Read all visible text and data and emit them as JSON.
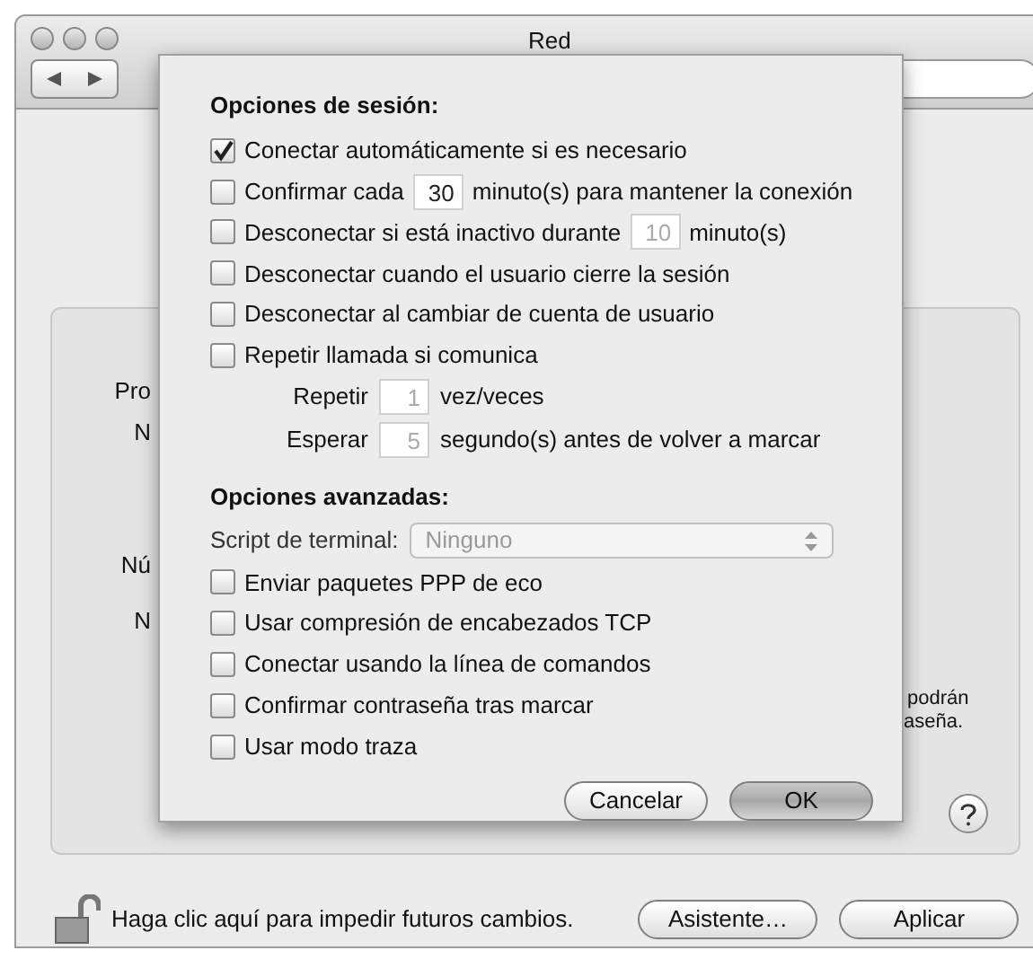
{
  "window": {
    "title": "Red"
  },
  "background_fragments": {
    "left": [
      "Pro",
      "N",
      "Nú",
      "N"
    ],
    "right": [
      "podrán",
      "aseña."
    ]
  },
  "sheet": {
    "session_title": "Opciones de sesión:",
    "session_options": [
      {
        "kind": "checkbox",
        "label": "Conectar automáticamente si es necesario",
        "checked": true
      },
      {
        "kind": "checkbox_field",
        "label": "Confirmar cada",
        "value": "30",
        "suffix": "minuto(s) para mantener la conexión",
        "checked": false,
        "field_disabled": false
      },
      {
        "kind": "checkbox_field",
        "label": "Desconectar si está inactivo durante",
        "value": "10",
        "suffix": "minuto(s)",
        "checked": false,
        "field_disabled": true
      },
      {
        "kind": "checkbox",
        "label": "Desconectar cuando el usuario cierre la sesión",
        "checked": false
      },
      {
        "kind": "checkbox",
        "label": "Desconectar al cambiar de cuenta de usuario",
        "checked": false
      },
      {
        "kind": "checkbox",
        "label": "Repetir llamada si comunica",
        "checked": false
      },
      {
        "kind": "field",
        "label": "Repetir",
        "value": "1",
        "suffix": "vez/veces",
        "field_disabled": true
      },
      {
        "kind": "field",
        "label": "Esperar",
        "value": "5",
        "suffix": "segundo(s) antes de volver a marcar",
        "field_disabled": true
      }
    ],
    "advanced_title": "Opciones avanzadas:",
    "script": {
      "label": "Script de terminal:",
      "value": "Ninguno",
      "disabled": true
    },
    "advanced_options": [
      {
        "label": "Enviar paquetes PPP de eco",
        "checked": false
      },
      {
        "label": "Usar compresión de encabezados TCP",
        "checked": false
      },
      {
        "label": "Conectar usando la línea de comandos",
        "checked": false
      },
      {
        "label": "Confirmar contraseña tras marcar",
        "checked": false
      },
      {
        "label": "Usar modo traza",
        "checked": false
      }
    ],
    "buttons": [
      {
        "label": "Cancelar",
        "default": false
      },
      {
        "label": "OK",
        "default": true
      }
    ]
  },
  "footer": {
    "locked": false,
    "lock_text": "Haga clic aquí para impedir futuros cambios.",
    "buttons": [
      "Asistente…",
      "Aplicar"
    ]
  }
}
